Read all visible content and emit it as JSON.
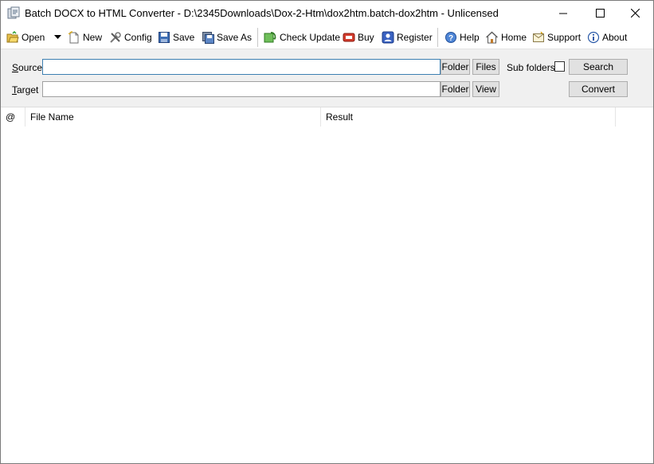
{
  "title": "Batch DOCX to HTML Converter - D:\\2345Downloads\\Dox-2-Htm\\dox2htm.batch-dox2htm - Unlicensed",
  "toolbar": {
    "open": "Open",
    "new": "New",
    "config": "Config",
    "save": "Save",
    "save_as": "Save As",
    "check_update": "Check Update",
    "buy": "Buy",
    "register": "Register",
    "help": "Help",
    "home": "Home",
    "support": "Support",
    "about": "About"
  },
  "form": {
    "source_label_underlined": "S",
    "source_label_rest": "ource",
    "target_label_underlined": "T",
    "target_label_rest": "arget",
    "source_value": "",
    "target_value": "",
    "source_folder_btn": "Folder",
    "source_files_btn": "Files",
    "subfolders_label": "Sub folders",
    "subfolders_checked": false,
    "search_btn": "Search",
    "target_folder_btn": "Folder",
    "target_view_btn": "View",
    "convert_btn": "Convert"
  },
  "list": {
    "columns": [
      "@",
      "File Name",
      "Result"
    ],
    "rows": []
  }
}
